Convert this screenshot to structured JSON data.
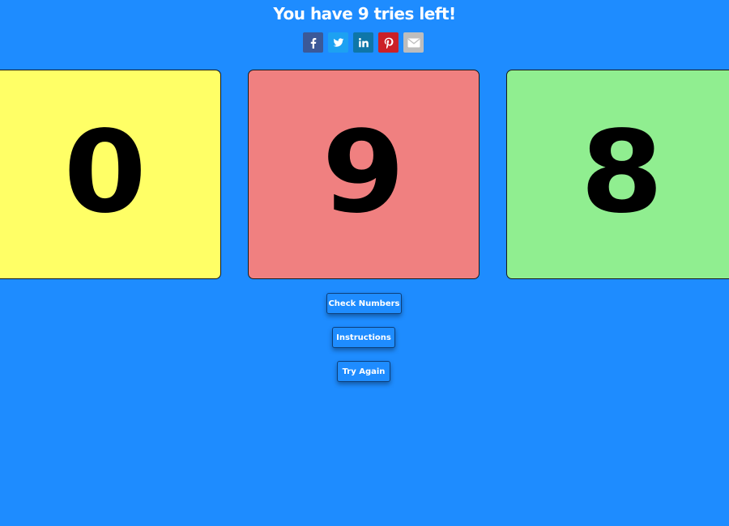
{
  "header": {
    "title": "You have 9 tries left!"
  },
  "share": {
    "items": [
      {
        "icon": "facebook-icon",
        "color": "#3b5998"
      },
      {
        "icon": "twitter-icon",
        "color": "#1da1f2"
      },
      {
        "icon": "linkedin-icon",
        "color": "#0e76a8"
      },
      {
        "icon": "pinterest-icon",
        "color": "#cb2027"
      },
      {
        "icon": "email-icon",
        "color": "#bdbdbd"
      }
    ]
  },
  "cards": [
    {
      "digit": "0",
      "color": "#ffff66"
    },
    {
      "digit": "9",
      "color": "#f08080"
    },
    {
      "digit": "8",
      "color": "#90ee90"
    }
  ],
  "buttons": {
    "check_label": "Check Numbers",
    "instructions_label": "Instructions",
    "try_again_label": "Try Again"
  },
  "colors": {
    "background": "#1e8cff"
  }
}
